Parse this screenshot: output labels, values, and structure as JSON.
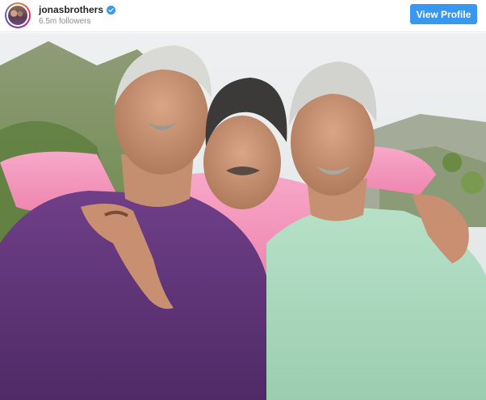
{
  "header": {
    "username": "jonasbrothers",
    "followers": "6.5m followers",
    "view_profile_label": "View Profile",
    "verified_icon": "verified-badge-icon",
    "accent_color": "#3897f0"
  },
  "post": {
    "image_icon": "photo-of-three-men-in-sweaters"
  }
}
